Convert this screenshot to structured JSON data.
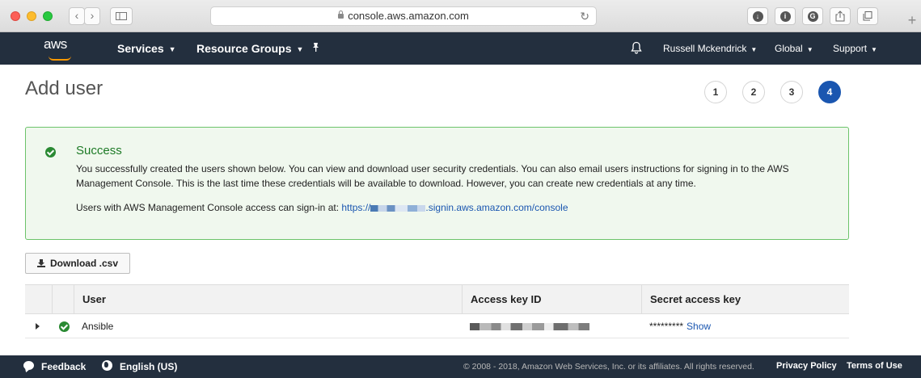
{
  "browser": {
    "url": "console.aws.amazon.com"
  },
  "nav": {
    "logo": "aws",
    "services": "Services",
    "resource_groups": "Resource Groups",
    "user": "Russell Mckendrick",
    "region": "Global",
    "support": "Support"
  },
  "page": {
    "title": "Add user",
    "steps": [
      "1",
      "2",
      "3",
      "4"
    ],
    "active_step": "4"
  },
  "success": {
    "title": "Success",
    "message": "You successfully created the users shown below. You can view and download user security credentials. You can also email users instructions for signing in to the AWS Management Console. This is the last time these credentials will be available to download. However, you can create new credentials at any time.",
    "signin_prefix": "Users with AWS Management Console access can sign-in at:",
    "signin_link_start": "https://",
    "signin_link_end": ".signin.aws.amazon.com/console"
  },
  "download_button": "Download .csv",
  "table": {
    "headers": {
      "user": "User",
      "access_key": "Access key ID",
      "secret_key": "Secret access key"
    },
    "rows": [
      {
        "user": "Ansible",
        "secret_mask": "*********",
        "show": "Show"
      }
    ]
  },
  "footer": {
    "feedback": "Feedback",
    "language": "English (US)",
    "copyright": "© 2008 - 2018, Amazon Web Services, Inc. or its affiliates. All rights reserved.",
    "privacy": "Privacy Policy",
    "terms": "Terms of Use"
  },
  "colors": {
    "nav_bg": "#232f3e",
    "accent_orange": "#ff9900",
    "step_active": "#1a56b0",
    "success_green": "#2a8a33",
    "success_bg": "#f0f8ee",
    "link_blue": "#1a56b0"
  }
}
